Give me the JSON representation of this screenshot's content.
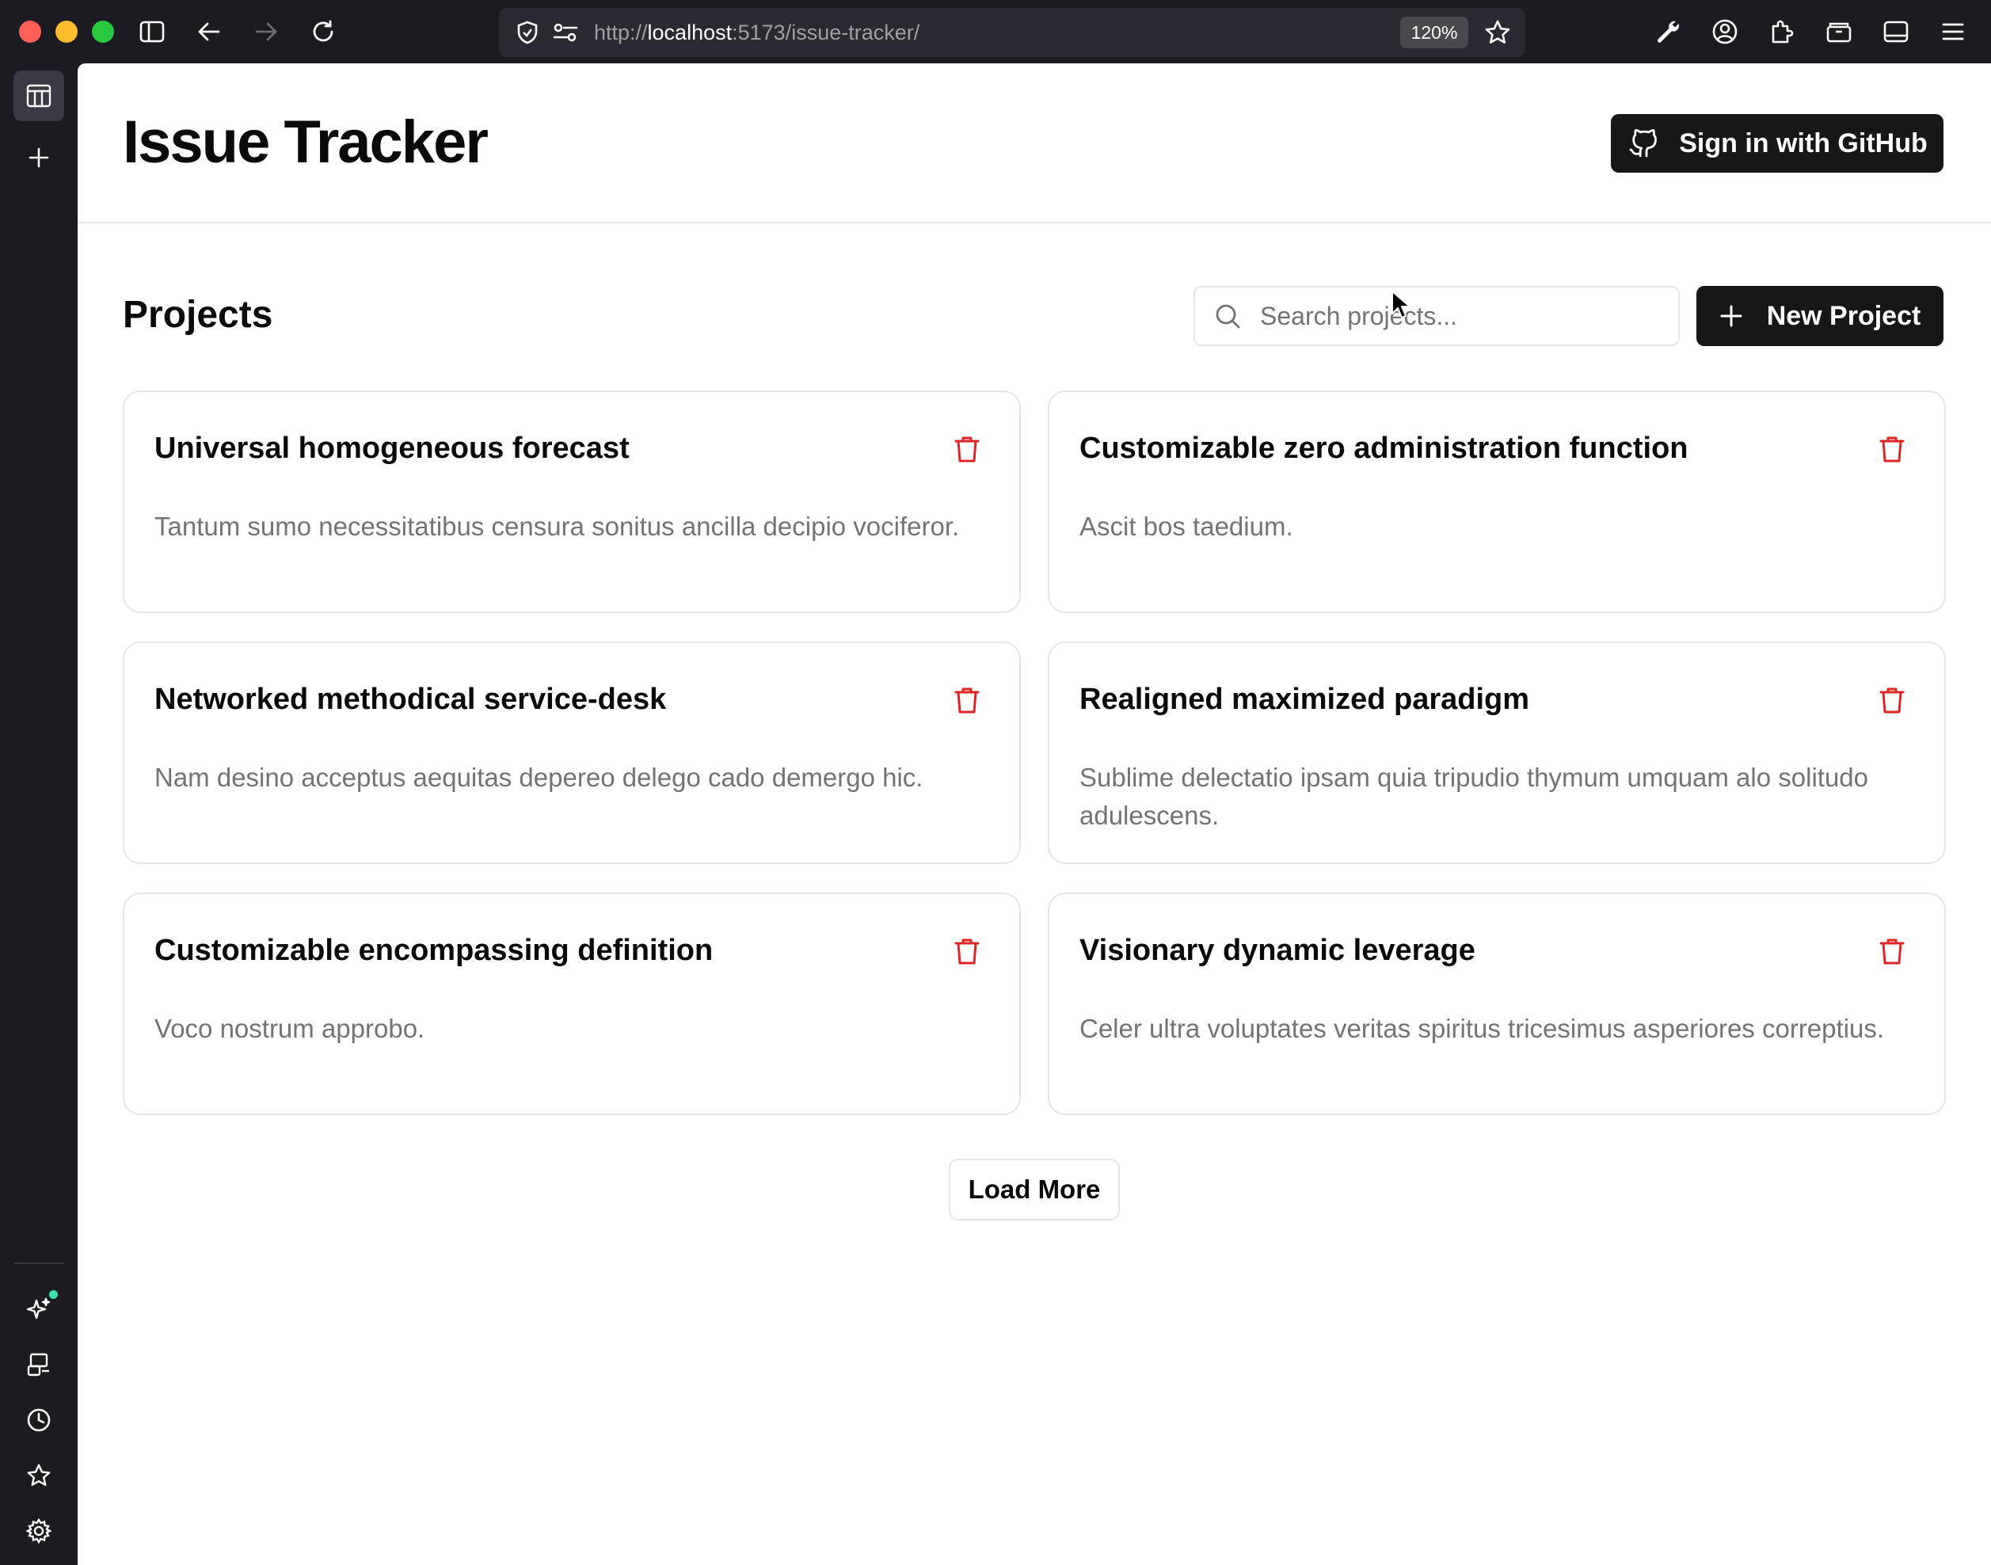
{
  "browser": {
    "url_prefix": "http://",
    "url_host": "localhost",
    "url_rest": ":5173/issue-tracker/",
    "zoom": "120%",
    "icons": [
      "sidebar-toggle-icon",
      "back-icon",
      "forward-icon",
      "reload-icon",
      "shield-icon",
      "permissions-icon",
      "star-icon",
      "wrench-icon",
      "account-icon",
      "extensions-icon",
      "container-icon",
      "sidebar-icon",
      "menu-icon"
    ]
  },
  "app": {
    "title": "Issue Tracker",
    "sign_in_label": "Sign in with GitHub"
  },
  "projects": {
    "heading": "Projects",
    "search_placeholder": "Search projects...",
    "new_project_label": "New Project",
    "load_more_label": "Load More",
    "items": [
      {
        "title": "Universal homogeneous forecast",
        "description": "Tantum sumo necessitatibus censura sonitus ancilla decipio vociferor."
      },
      {
        "title": "Customizable zero administration function",
        "description": "Ascit bos taedium."
      },
      {
        "title": "Networked methodical service-desk",
        "description": "Nam desino acceptus aequitas depereo delego cado demergo hic."
      },
      {
        "title": "Realigned maximized paradigm",
        "description": "Sublime delectatio ipsam quia tripudio thymum umquam alo solitudo adulescens."
      },
      {
        "title": "Customizable encompassing definition",
        "description": "Voco nostrum approbo."
      },
      {
        "title": "Visionary dynamic leverage",
        "description": "Celer ultra voluptates veritas spiritus tricesimus asperiores correptius."
      }
    ]
  },
  "colors": {
    "chrome_bg": "#1c1b22",
    "urlbar_bg": "#2b2a33",
    "primary_button": "#171717",
    "delete_icon": "#dc2626",
    "muted_text": "#737373",
    "border": "#e5e5e5"
  }
}
